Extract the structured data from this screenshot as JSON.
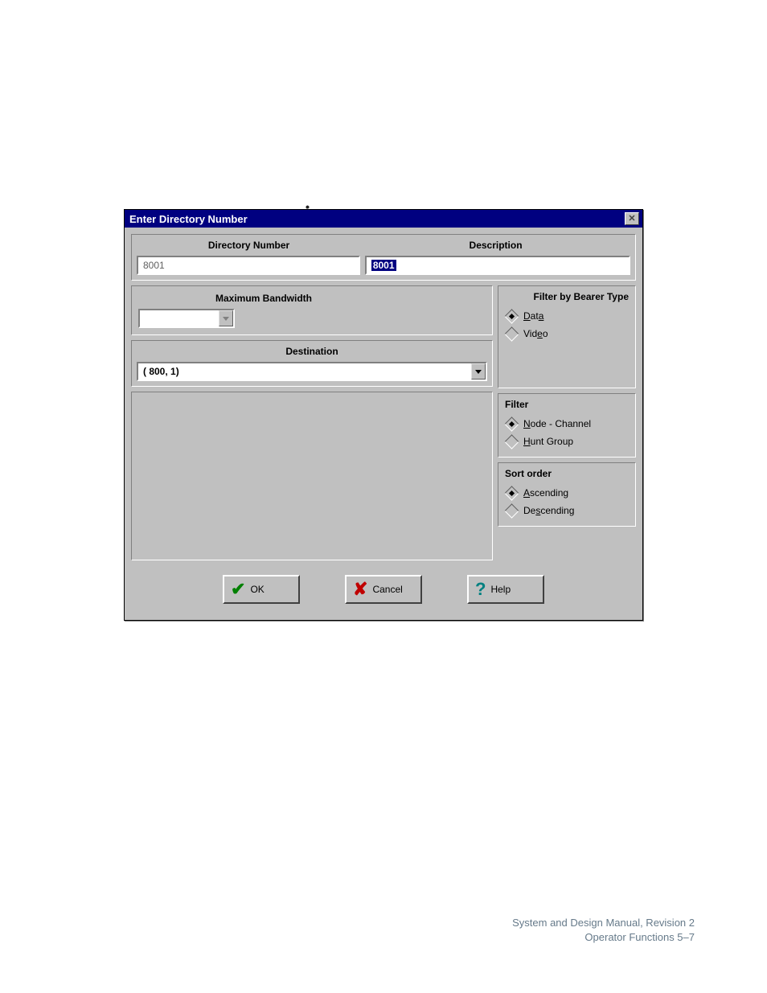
{
  "bullets": [
    "",
    "",
    "",
    ""
  ],
  "dialog": {
    "title": "Enter Directory Number",
    "labels": {
      "directory_number": "Directory Number",
      "description": "Description",
      "max_bandwidth": "Maximum Bandwidth",
      "filter_bearer": "Filter by Bearer Type",
      "destination": "Destination",
      "filter": "Filter",
      "sort_order": "Sort order"
    },
    "fields": {
      "directory_number": "8001",
      "description": "8001",
      "max_bandwidth": "",
      "destination": "(  800, 1)"
    },
    "bearer": {
      "data": "Data",
      "video": "Video",
      "selected": "data"
    },
    "filter": {
      "node_channel": "Node - Channel",
      "hunt_group": "Hunt Group",
      "selected": "node_channel"
    },
    "sort": {
      "ascending": "Ascending",
      "descending": "Descending",
      "selected": "ascending"
    },
    "buttons": {
      "ok": "OK",
      "cancel": "Cancel",
      "help": "Help"
    }
  },
  "footer": {
    "line1": "System and Design Manual, Revision 2",
    "line2": "Operator Functions  5–7"
  }
}
